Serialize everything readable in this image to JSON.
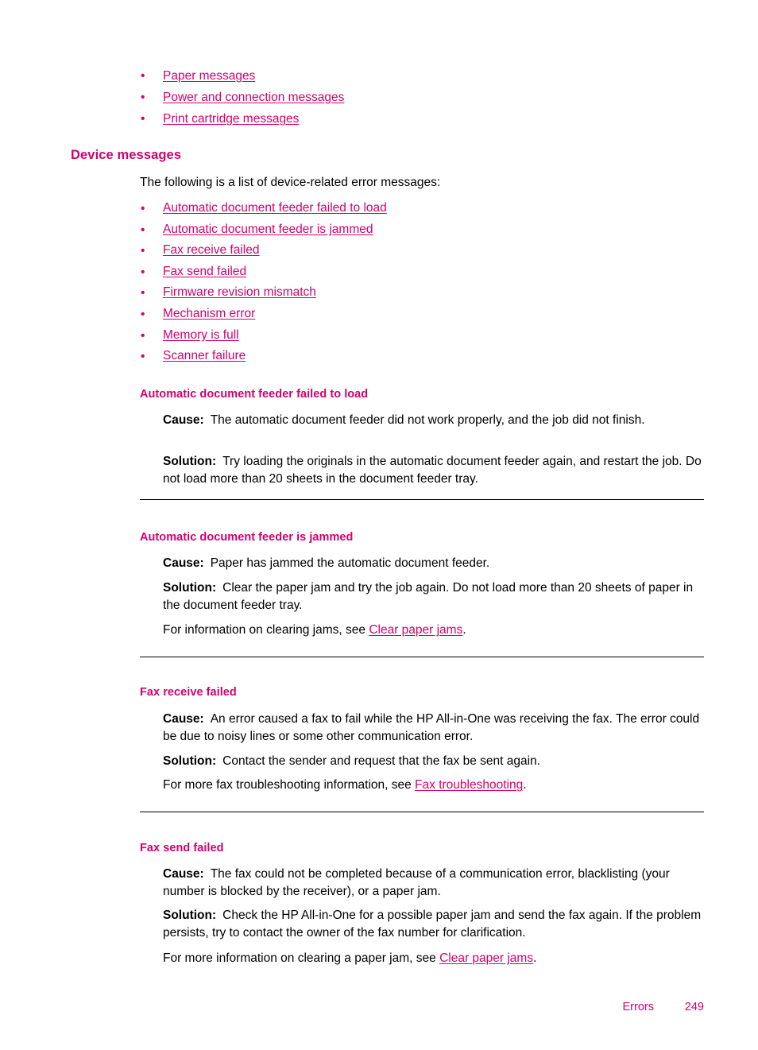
{
  "page": {
    "number": "249",
    "footer_label": "Errors"
  },
  "colors": {
    "accent": "#d3006e",
    "text": "#000000",
    "rule": "#000000",
    "background": "#ffffff"
  },
  "top_links": [
    {
      "label": "Paper messages"
    },
    {
      "label": "Power and connection messages"
    },
    {
      "label": "Print cartridge messages"
    }
  ],
  "section": {
    "heading": "Device messages",
    "intro": "The following is a list of device-related error messages:",
    "links": [
      {
        "label": "Automatic document feeder failed to load"
      },
      {
        "label": "Automatic document feeder is jammed"
      },
      {
        "label": "Fax receive failed"
      },
      {
        "label": "Fax send failed"
      },
      {
        "label": "Firmware revision mismatch"
      },
      {
        "label": "Mechanism error"
      },
      {
        "label": "Memory is full"
      },
      {
        "label": "Scanner failure"
      }
    ]
  },
  "labels": {
    "cause": "Cause:",
    "solution": "Solution:",
    "bullet": "•"
  },
  "topics": [
    {
      "title": "Automatic document feeder failed to load",
      "cause": "The automatic document feeder did not work properly, and the job did not finish.",
      "solution": "Try loading the originals in the automatic document feeder again, and restart the job. Do not load more than 20 sheets in the document feeder tray.",
      "note_before": "",
      "note_link": "",
      "note_after": ""
    },
    {
      "title": "Automatic document feeder is jammed",
      "cause": "Paper has jammed the automatic document feeder.",
      "solution": "Clear the paper jam and try the job again. Do not load more than 20 sheets of paper in the document feeder tray.",
      "note_before": "For information on clearing jams, see ",
      "note_link": "Clear paper jams",
      "note_after": "."
    },
    {
      "title": "Fax receive failed",
      "cause": "An error caused a fax to fail while the HP All-in-One was receiving the fax. The error could be due to noisy lines or some other communication error.",
      "solution": "Contact the sender and request that the fax be sent again.",
      "note_before": "For more fax troubleshooting information, see ",
      "note_link": "Fax troubleshooting",
      "note_after": "."
    },
    {
      "title": "Fax send failed",
      "cause": "The fax could not be completed because of a communication error, blacklisting (your number is blocked by the receiver), or a paper jam.",
      "solution": "Check the HP All-in-One for a possible paper jam and send the fax again. If the problem persists, try to contact the owner of the fax number for clarification.",
      "note_before": "For more information on clearing a paper jam, see ",
      "note_link": "Clear paper jams",
      "note_after": "."
    }
  ]
}
